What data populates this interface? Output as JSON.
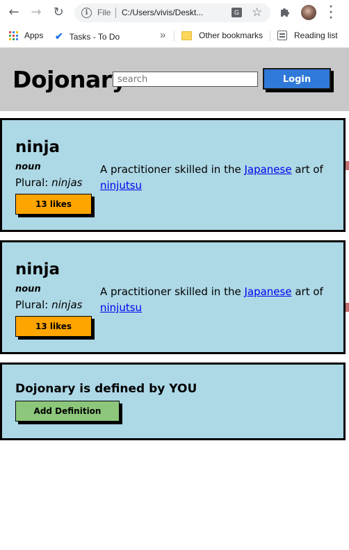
{
  "browser": {
    "omnibox": {
      "scheme_label": "File",
      "url": "C:/Users/vivis/Deskt..."
    },
    "bookmarks": [
      {
        "label": "Apps",
        "icon": "apps-grid-icon"
      },
      {
        "label": "Tasks - To Do",
        "icon": "check-icon"
      },
      {
        "label": "Other bookmarks",
        "icon": "folder-icon"
      },
      {
        "label": "Reading list",
        "icon": "reading-list-icon"
      }
    ],
    "overflow_label": "»"
  },
  "header": {
    "logo": "Dojonary",
    "search_placeholder": "search",
    "login_label": "Login",
    "colors": {
      "header_bg": "#c8c8c8",
      "login_bg": "#2f79d9"
    }
  },
  "entries": [
    {
      "word": "ninja",
      "part_of_speech": "noun",
      "plural_label": "Plural:",
      "plural": "ninjas",
      "likes_label": "13 likes",
      "definition_before": "A practitioner skilled in the ",
      "definition_link1": "Japanese",
      "definition_mid": " art of ",
      "definition_link2": "ninjutsu"
    },
    {
      "word": "ninja",
      "part_of_speech": "noun",
      "plural_label": "Plural:",
      "plural": "ninjas",
      "likes_label": "13 likes",
      "definition_before": "A practitioner skilled in the ",
      "definition_link1": "Japanese",
      "definition_mid": " art of ",
      "definition_link2": "ninjutsu"
    }
  ],
  "cta": {
    "text": "Dojonary is defined by YOU",
    "button_label": "Add Definition"
  },
  "colors": {
    "card_bg": "#add8e6",
    "likes_bg": "#ffa500",
    "add_bg": "#8dc77b",
    "link": "#0000ee"
  }
}
